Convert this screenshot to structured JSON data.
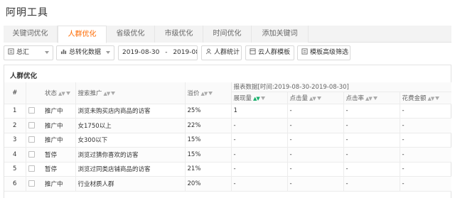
{
  "app": {
    "title": "阿明工具"
  },
  "tabs": [
    {
      "label": "关键词优化",
      "active": false
    },
    {
      "label": "人群优化",
      "active": true
    },
    {
      "label": "省级优化",
      "active": false
    },
    {
      "label": "市级优化",
      "active": false
    },
    {
      "label": "时间优化",
      "active": false
    },
    {
      "label": "添加关键词",
      "active": false
    }
  ],
  "toolbar": {
    "summary_select": "总汇",
    "conversion_select": "总转化数据",
    "date_start": "2019-08-30",
    "date_sep": "-",
    "date_end": "2019-08-30",
    "crowd_stats_button": "人群统计",
    "cloud_template_button": "云人群模板",
    "advanced_filter_button": "模板高级筛选"
  },
  "panel": {
    "title": "人群优化"
  },
  "table": {
    "headers": {
      "index": "#",
      "status": "状态",
      "crowd": "搜索推广",
      "premium": "溢价",
      "report_group": "报表数据[时间:2019-08-30-2019-08-30]",
      "impressions": "展现量",
      "clicks": "点击量",
      "ctr": "点击率",
      "spend": "花费金额"
    },
    "rows": [
      {
        "index": "1",
        "status": "推广中",
        "status_type": "on",
        "crowd": "浏览未购买店内商品的访客",
        "premium": "25%",
        "impressions": "1",
        "clicks": "-",
        "ctr": "-",
        "spend": "-"
      },
      {
        "index": "2",
        "status": "推广中",
        "status_type": "on",
        "crowd": "女1750以上",
        "premium": "22%",
        "impressions": "-",
        "clicks": "-",
        "ctr": "-",
        "spend": "-"
      },
      {
        "index": "3",
        "status": "推广中",
        "status_type": "on",
        "crowd": "女300以下",
        "premium": "15%",
        "impressions": "-",
        "clicks": "-",
        "ctr": "-",
        "spend": "-"
      },
      {
        "index": "4",
        "status": "暂停",
        "status_type": "pause",
        "crowd": "浏览过猜你喜欢的访客",
        "premium": "15%",
        "impressions": "-",
        "clicks": "-",
        "ctr": "-",
        "spend": "-"
      },
      {
        "index": "5",
        "status": "暂停",
        "status_type": "pause",
        "crowd": "浏览过同类店铺商品的访客",
        "premium": "21%",
        "impressions": "-",
        "clicks": "-",
        "ctr": "-",
        "spend": "-"
      },
      {
        "index": "6",
        "status": "推广中",
        "status_type": "on",
        "crowd": "行业材质人群",
        "premium": "20%",
        "impressions": "-",
        "clicks": "-",
        "ctr": "-",
        "spend": "-"
      }
    ]
  },
  "colors": {
    "accent": "#ff6a00",
    "status_on": "#2aa44a",
    "status_pause": "#ff8a00",
    "sort_active": "#16b06b"
  }
}
